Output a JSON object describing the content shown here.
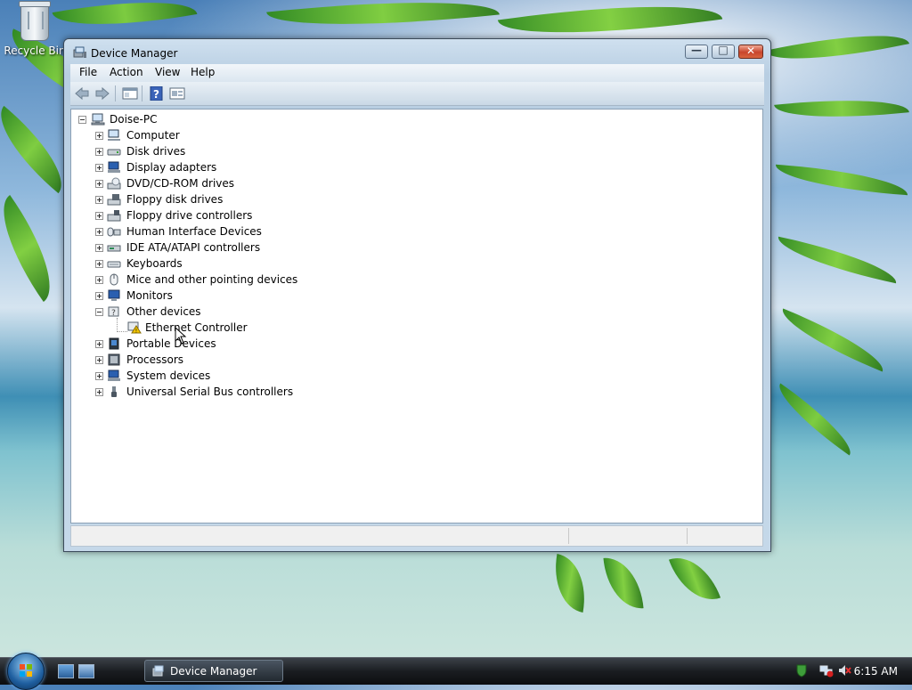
{
  "desktop": {
    "recycle_bin_label": "Recycle Bin"
  },
  "window": {
    "title": "Device Manager",
    "buttons": {
      "minimize": "—",
      "maximize": "□",
      "close": "✕"
    },
    "menu": [
      "File",
      "Action",
      "View",
      "Help"
    ],
    "toolbar": [
      "back-icon",
      "forward-icon",
      "properties-view-icon",
      "help-icon",
      "device-panel-icon"
    ]
  },
  "tree": {
    "root": "Doise-PC",
    "categories": [
      {
        "label": "Computer",
        "icon": "computer-icon",
        "expanded": false
      },
      {
        "label": "Disk drives",
        "icon": "disk-drive-icon",
        "expanded": false
      },
      {
        "label": "Display adapters",
        "icon": "display-adapter-icon",
        "expanded": false
      },
      {
        "label": "DVD/CD-ROM drives",
        "icon": "dvd-drive-icon",
        "expanded": false
      },
      {
        "label": "Floppy disk drives",
        "icon": "floppy-drive-icon",
        "expanded": false
      },
      {
        "label": "Floppy drive controllers",
        "icon": "floppy-controller-icon",
        "expanded": false
      },
      {
        "label": "Human Interface Devices",
        "icon": "hid-icon",
        "expanded": false
      },
      {
        "label": "IDE ATA/ATAPI controllers",
        "icon": "ide-controller-icon",
        "expanded": false
      },
      {
        "label": "Keyboards",
        "icon": "keyboard-icon",
        "expanded": false
      },
      {
        "label": "Mice and other pointing devices",
        "icon": "mouse-icon",
        "expanded": false
      },
      {
        "label": "Monitors",
        "icon": "monitor-icon",
        "expanded": false
      },
      {
        "label": "Other devices",
        "icon": "other-devices-icon",
        "expanded": true,
        "children": [
          {
            "label": "Ethernet Controller",
            "icon": "warning-device-icon"
          }
        ]
      },
      {
        "label": "Portable Devices",
        "icon": "portable-device-icon",
        "expanded": false
      },
      {
        "label": "Processors",
        "icon": "processor-icon",
        "expanded": false
      },
      {
        "label": "System devices",
        "icon": "system-device-icon",
        "expanded": false
      },
      {
        "label": "Universal Serial Bus controllers",
        "icon": "usb-icon",
        "expanded": false
      }
    ]
  },
  "taskbar": {
    "task_label": "Device Manager",
    "clock": "6:15 AM"
  },
  "colors": {
    "accent": "#1f5fa0",
    "warning": "#f2c500",
    "close_button": "#c8452c"
  }
}
